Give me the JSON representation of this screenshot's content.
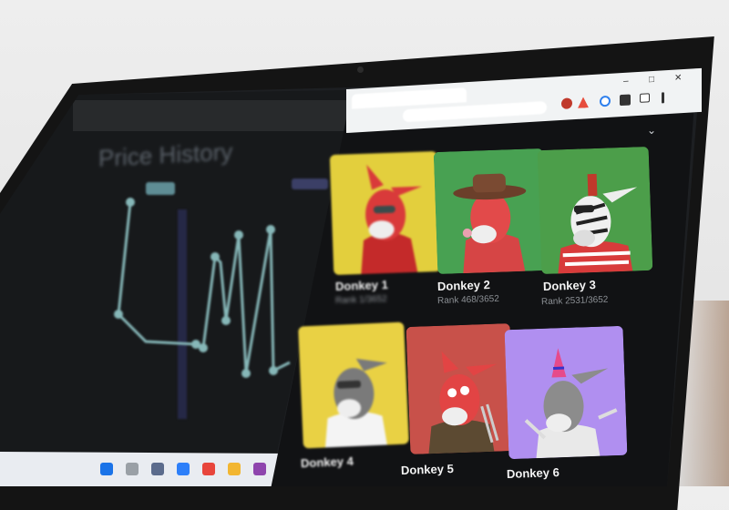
{
  "left_window": {
    "title": "Price History"
  },
  "browser": {
    "tab_title": "",
    "url": "",
    "window_controls": [
      "–",
      "□",
      "✕"
    ]
  },
  "nfts": [
    {
      "name": "Donkey 1",
      "rank": "Rank 1/3652",
      "bg": "#e3cf3d"
    },
    {
      "name": "Donkey 2",
      "rank": "Rank 468/3652",
      "bg": "#48a152"
    },
    {
      "name": "Donkey 3",
      "rank": "Rank 2531/3652",
      "bg": "#4c9e4a"
    },
    {
      "name": "Donkey 4",
      "rank": "",
      "bg": "#e9d144"
    },
    {
      "name": "Donkey 5",
      "rank": "",
      "bg": "#c8514a"
    },
    {
      "name": "Donkey 6",
      "rank": "",
      "bg": "#b08ff0"
    }
  ],
  "icons": {
    "collapse": "chevron-down-icon",
    "extensions": [
      "profile-icon",
      "triangle-icon",
      "globe-icon",
      "puzzle-icon",
      "sidebar-icon",
      "menu-icon"
    ]
  },
  "colors": {
    "screen_bg": "#1d1f22",
    "chart_line": "#7fb0b2",
    "taskbar": "#e9ecf1"
  }
}
